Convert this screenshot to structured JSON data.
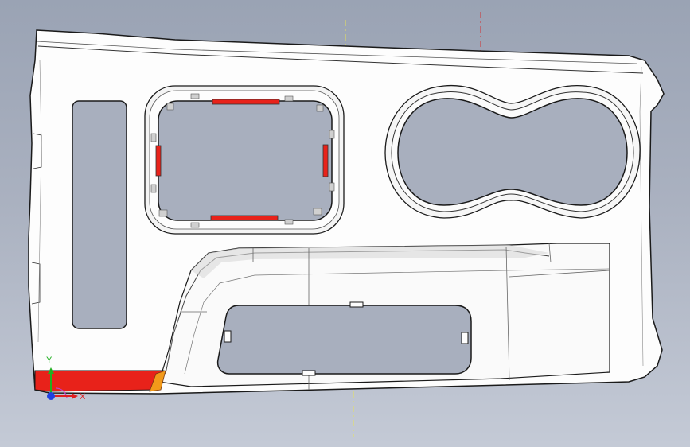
{
  "viewport": {
    "background_top": "#9aa3b4",
    "background_bottom": "#c4cad6"
  },
  "part": {
    "body_color": "#fdfdfd",
    "edge_color": "#1a1a1a",
    "cutout_color": "#a8afbe",
    "highlight_color": "#e8221a",
    "highlight_accent": "#f29a1a",
    "clip_color": "#d0d0d0"
  },
  "triad": {
    "x_label": "X",
    "y_label": "Y",
    "x_color": "#e02020",
    "y_color": "#20b020",
    "z_color": "#2040e0"
  },
  "reference_lines": {
    "left_color": "#e8e25a",
    "right_color": "#d23030"
  }
}
